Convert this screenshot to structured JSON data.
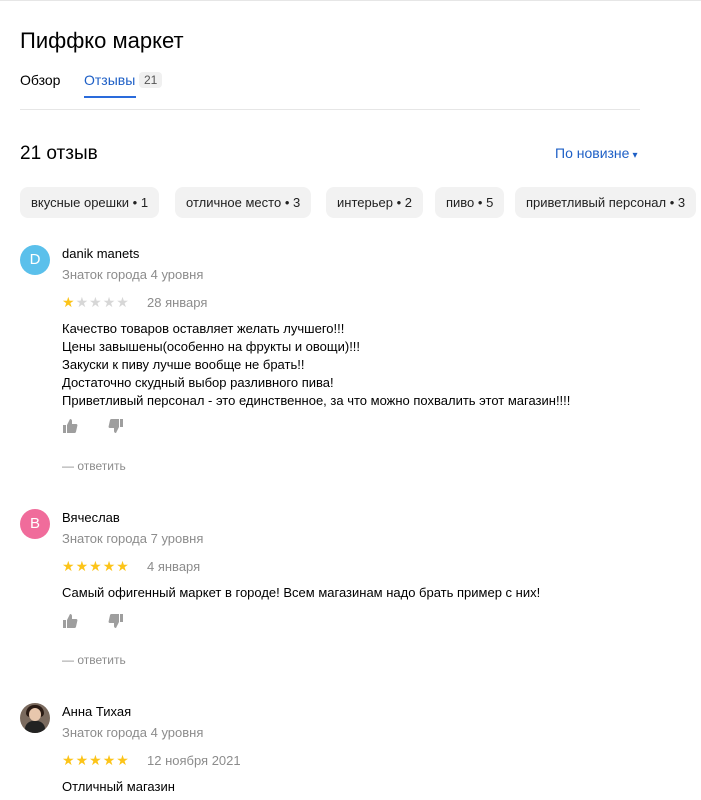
{
  "page": {
    "title": "Пиффко маркет"
  },
  "tabs": [
    {
      "label": "Обзор"
    },
    {
      "label": "Отзывы",
      "count": "21",
      "active": true
    }
  ],
  "reviews_section": {
    "heading": "21 отзыв",
    "sort_label": "По новизне",
    "sort_caret": "▾"
  },
  "chips": [
    {
      "label": "вкусные орешки",
      "count": "1"
    },
    {
      "label": "отличное место",
      "count": "3"
    },
    {
      "label": "интерьер",
      "count": "2"
    },
    {
      "label": "пиво",
      "count": "5"
    },
    {
      "label": "приветливый персонал",
      "count": "3"
    }
  ],
  "reviews": [
    {
      "author": "danik manets",
      "avatar_letter": "D",
      "avatar_color": "#5bc0eb",
      "level": "Знаток города 4 уровня",
      "rating": 1,
      "date": "28 января",
      "lines": [
        "Качество товаров оставляет желать лучшего!!!",
        "Цены завышены(особенно на фрукты и овощи)!!!",
        "Закуски к пиву лучше вообще не брать!!",
        "Достаточно скудный выбор разливного пива!",
        "Приветливый персонал - это единственное, за что можно похвалить этот магазин!!!!"
      ],
      "reply": "— ответить"
    },
    {
      "author": "Вячеслав",
      "avatar_letter": "В",
      "avatar_color": "#f06c9b",
      "level": "Знаток города 7 уровня",
      "rating": 5,
      "date": "4 января",
      "lines": [
        "Самый офигенный маркет в городе! Всем магазинам надо брать пример с них!"
      ],
      "reply": "— ответить"
    },
    {
      "author": "Анна Тихая",
      "avatar_letter": "",
      "avatar_color": "#7a6a5e",
      "level": "Знаток города 4 уровня",
      "rating": 5,
      "date": "12 ноября 2021",
      "lines": [
        "Отличный магазин"
      ]
    }
  ],
  "colors": {
    "accent": "#1d5fc6",
    "star_on": "#fcc419",
    "star_off": "#d7d7d7",
    "muted": "#8c8c8c"
  },
  "icons": {
    "like": "thumb-up-icon",
    "dislike": "thumb-down-icon",
    "star": "star-icon"
  }
}
